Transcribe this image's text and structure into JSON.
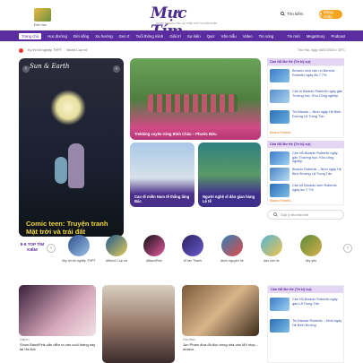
{
  "header": {
    "category_label": "Đời học",
    "logo_text": "Mực Tím",
    "tagline": "TRONG KHOẢNG KHẮC DÀI THIÊN THẬT NGUYÊN NHIÊN",
    "search_label": "Tìm kiếm",
    "login_label": "Đăng nhập"
  },
  "nav": {
    "items": [
      "Trang chủ",
      "Học đường",
      "Đời sống",
      "Xu hướng",
      "Gen Z",
      "Tuổi thông minh",
      "Giải trí",
      "Sự kiện",
      "Quiz",
      "Văn mẫu",
      "Video",
      "Tin nóng"
    ],
    "right": [
      "Tin mới",
      "MegaStory",
      "Podcast"
    ]
  },
  "ticker": {
    "items": [
      "Kỳ thi tốt nghiệp THPT",
      "World Cup nữ"
    ],
    "date": "Thứ Hai, ngày 08/07/2023 • 30°C"
  },
  "featured": {
    "image_title": "Sun & Earth",
    "title": "Comic teen: Truyện tranh Mặt trời và trái đất"
  },
  "cards": [
    {
      "caption": "Trekking xuyên rừng Bình Châu – Phước Bửu"
    },
    {
      "caption": "Cao đi miền Nam tế thắng lăng Bác"
    },
    {
      "caption": "Người nghệ sĩ dân gian hàng Lệ tế"
    }
  ],
  "sidebar": {
    "boxes": [
      {
        "header": "Cần Nỗ Bơ Hé (Tờ kỹ sự)",
        "rows": [
          {
            "text": "Boranic xem cản nó Boranic Robertic ngày ẩn 7.7%"
          },
          {
            "text": "Cận ló Bizanic Robertic ngày gần Trường học, Khu Công nghiệp"
          },
          {
            "text": "Tin Bizanic – Nhìn ngày Hệ Binh Đường Lã Trọng Tấn"
          }
        ],
        "source": "Bizanic Robertic"
      },
      {
        "header": "Cần Nỗ Bơ Hé (Tờ kỹ sự)",
        "rows": [
          {
            "text": "Cản Nỗ Bizanic Robertic ngày gần Thường học, Khu công nghiệp"
          },
          {
            "text": "Bizanic Robertic – Nhìn ngày Hệ Binh Đường Lã Trọng Tấn"
          },
          {
            "text": "Cản nỗ Boranic xem Robertic ngày dự 7.7%"
          }
        ],
        "source": "Bizanic Robertic"
      }
    ],
    "search_placeholder": "Góp ý cho bài mới"
  },
  "trending": {
    "label": "8-8 TOP TÌM KIẾM",
    "tags": [
      "#kỳ thi tốt nghiệp THPT",
      "#World Cup nữ",
      "#BlackPink",
      "#Trấn Thành",
      "#tình nguyện hè",
      "#du lịch hè",
      "#kỳ yếu"
    ]
  },
  "bottom": {
    "cards": [
      {
        "category": "Giải trí",
        "caption": "Show BlackPink vẫn diễn ra vào cuối tháng này tại Hà Nội"
      },
      {
        "category": "",
        "caption": ""
      },
      {
        "category": "Gia đình",
        "caption": "Jun Pham đưa đồ đọc trong nhà vào MV stop – motion"
      }
    ],
    "side": {
      "header": "Cần Nỗ Bơ Hé (Tờ kỹ sự)",
      "rows": [
        {
          "text": "Cản Nỗ Bizanic Robertic ngày gần Lã Trọng Tấn"
        },
        {
          "text": "Tin Bizanic Robertic – Nhìn ngày Hệ Binh Đường"
        }
      ]
    }
  },
  "colors": {
    "brand": "#5a2ca0",
    "accent": "#f5a623",
    "headline": "#f0d63a"
  }
}
